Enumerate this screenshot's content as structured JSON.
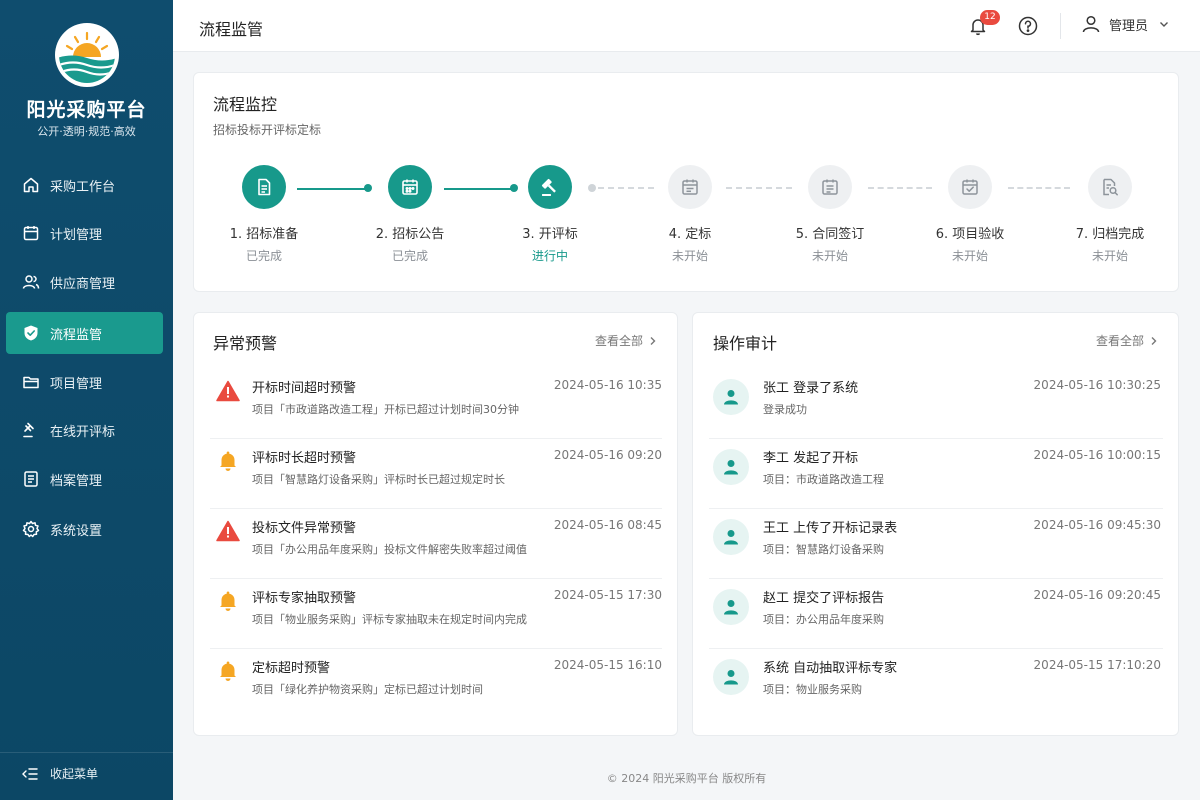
{
  "brand": {
    "title": "阳光采购平台",
    "subtitle": "公开·透明·规范·高效"
  },
  "sidebar": {
    "items": [
      {
        "label": "采购工作台",
        "icon": "home-icon"
      },
      {
        "label": "计划管理",
        "icon": "calendar-icon"
      },
      {
        "label": "供应商管理",
        "icon": "users-icon"
      },
      {
        "label": "流程监管",
        "icon": "shield-icon",
        "active": true
      },
      {
        "label": "项目管理",
        "icon": "folder-icon"
      },
      {
        "label": "在线开评标",
        "icon": "gavel-icon"
      },
      {
        "label": "档案管理",
        "icon": "archive-icon"
      },
      {
        "label": "系统设置",
        "icon": "gear-icon"
      }
    ],
    "collapse_label": "收起菜单"
  },
  "header": {
    "title": "流程监管",
    "notification_count": "12",
    "user_name": "管理员"
  },
  "process": {
    "title": "流程监控",
    "subtitle": "招标投标开评标定标",
    "steps": [
      {
        "label": "1. 招标准备",
        "status": "已完成",
        "state": "done"
      },
      {
        "label": "2. 招标公告",
        "status": "已完成",
        "state": "done"
      },
      {
        "label": "3. 开评标",
        "status": "进行中",
        "state": "current"
      },
      {
        "label": "4. 定标",
        "status": "未开始",
        "state": "todo"
      },
      {
        "label": "5. 合同签订",
        "status": "未开始",
        "state": "todo"
      },
      {
        "label": "6. 项目验收",
        "status": "未开始",
        "state": "todo"
      },
      {
        "label": "7. 归档完成",
        "status": "未开始",
        "state": "todo"
      }
    ]
  },
  "alerts": {
    "title": "异常预警",
    "view_all": "查看全部",
    "items": [
      {
        "title": "开标时间超时预警",
        "desc": "项目「市政道路改造工程」开标已超过计划时间30分钟",
        "time": "2024-05-16 10:35",
        "level": "danger"
      },
      {
        "title": "评标时长超时预警",
        "desc": "项目「智慧路灯设备采购」评标时长已超过规定时长",
        "time": "2024-05-16 09:20",
        "level": "warning"
      },
      {
        "title": "投标文件异常预警",
        "desc": "项目「办公用品年度采购」投标文件解密失败率超过阈值",
        "time": "2024-05-16 08:45",
        "level": "danger"
      },
      {
        "title": "评标专家抽取预警",
        "desc": "项目「物业服务采购」评标专家抽取未在规定时间内完成",
        "time": "2024-05-15 17:30",
        "level": "warning"
      },
      {
        "title": "定标超时预警",
        "desc": "项目「绿化养护物资采购」定标已超过计划时间",
        "time": "2024-05-15 16:10",
        "level": "warning"
      }
    ]
  },
  "audit": {
    "title": "操作审计",
    "view_all": "查看全部",
    "items": [
      {
        "title": "张工 登录了系统",
        "desc": "登录成功",
        "time": "2024-05-16 10:30:25"
      },
      {
        "title": "李工 发起了开标",
        "desc": "项目：市政道路改造工程",
        "time": "2024-05-16 10:00:15"
      },
      {
        "title": "王工 上传了开标记录表",
        "desc": "项目：智慧路灯设备采购",
        "time": "2024-05-16 09:45:30"
      },
      {
        "title": "赵工 提交了评标报告",
        "desc": "项目：办公用品年度采购",
        "time": "2024-05-16 09:20:45"
      },
      {
        "title": "系统 自动抽取评标专家",
        "desc": "项目：物业服务采购",
        "time": "2024-05-15 17:10:20"
      }
    ]
  },
  "footer": {
    "text": "© 2024 阳光采购平台 版权所有"
  },
  "colors": {
    "sidebar_bg": "#0f4d6e",
    "accent": "#17998b",
    "danger": "#e94a3f",
    "warning": "#f5a623"
  }
}
